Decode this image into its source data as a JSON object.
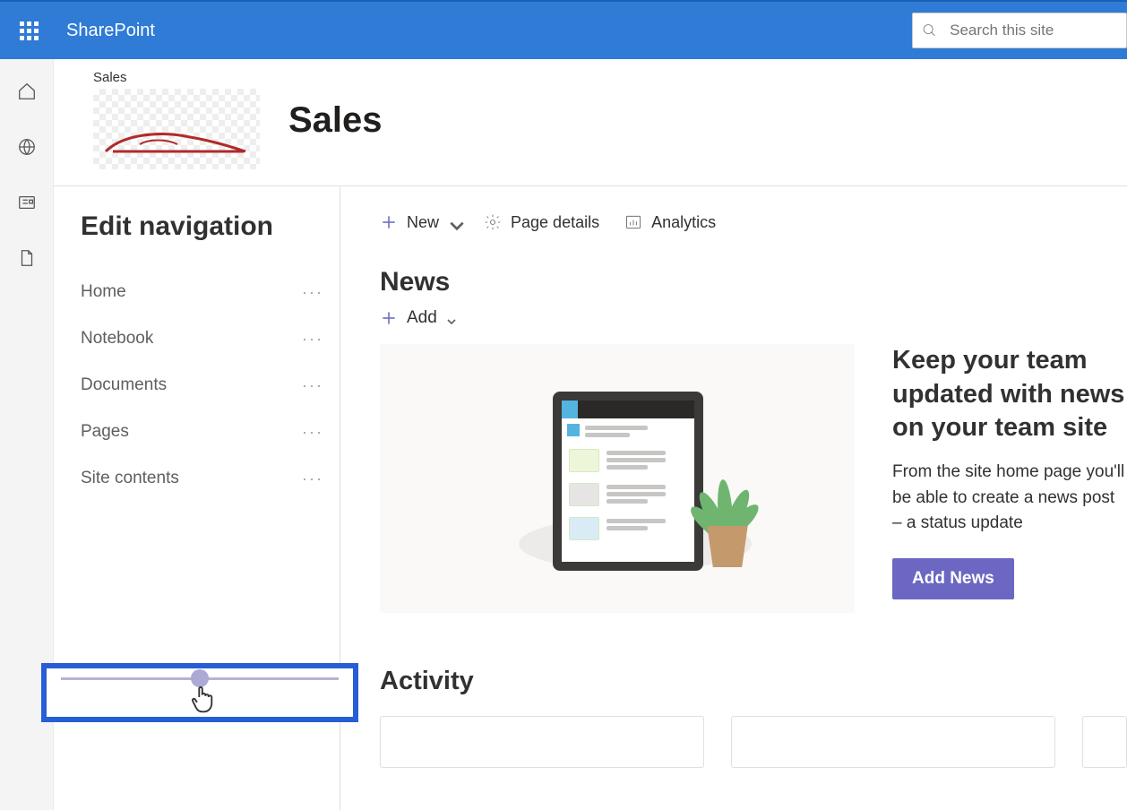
{
  "header": {
    "brand": "SharePoint",
    "search_placeholder": "Search this site"
  },
  "site": {
    "breadcrumb": "Sales",
    "title": "Sales"
  },
  "nav": {
    "title": "Edit navigation",
    "items": [
      {
        "label": "Home"
      },
      {
        "label": "Notebook"
      },
      {
        "label": "Documents"
      },
      {
        "label": "Pages"
      },
      {
        "label": "Site contents"
      }
    ]
  },
  "toolbar": {
    "new_label": "New",
    "page_details_label": "Page details",
    "analytics_label": "Analytics"
  },
  "news": {
    "section_title": "News",
    "add_label": "Add",
    "promo_title": "Keep your team updated with news on your team site",
    "promo_desc": "From the site home page you'll be able to create a news post – a status update",
    "button_label": "Add News"
  },
  "activity": {
    "section_title": "Activity"
  }
}
